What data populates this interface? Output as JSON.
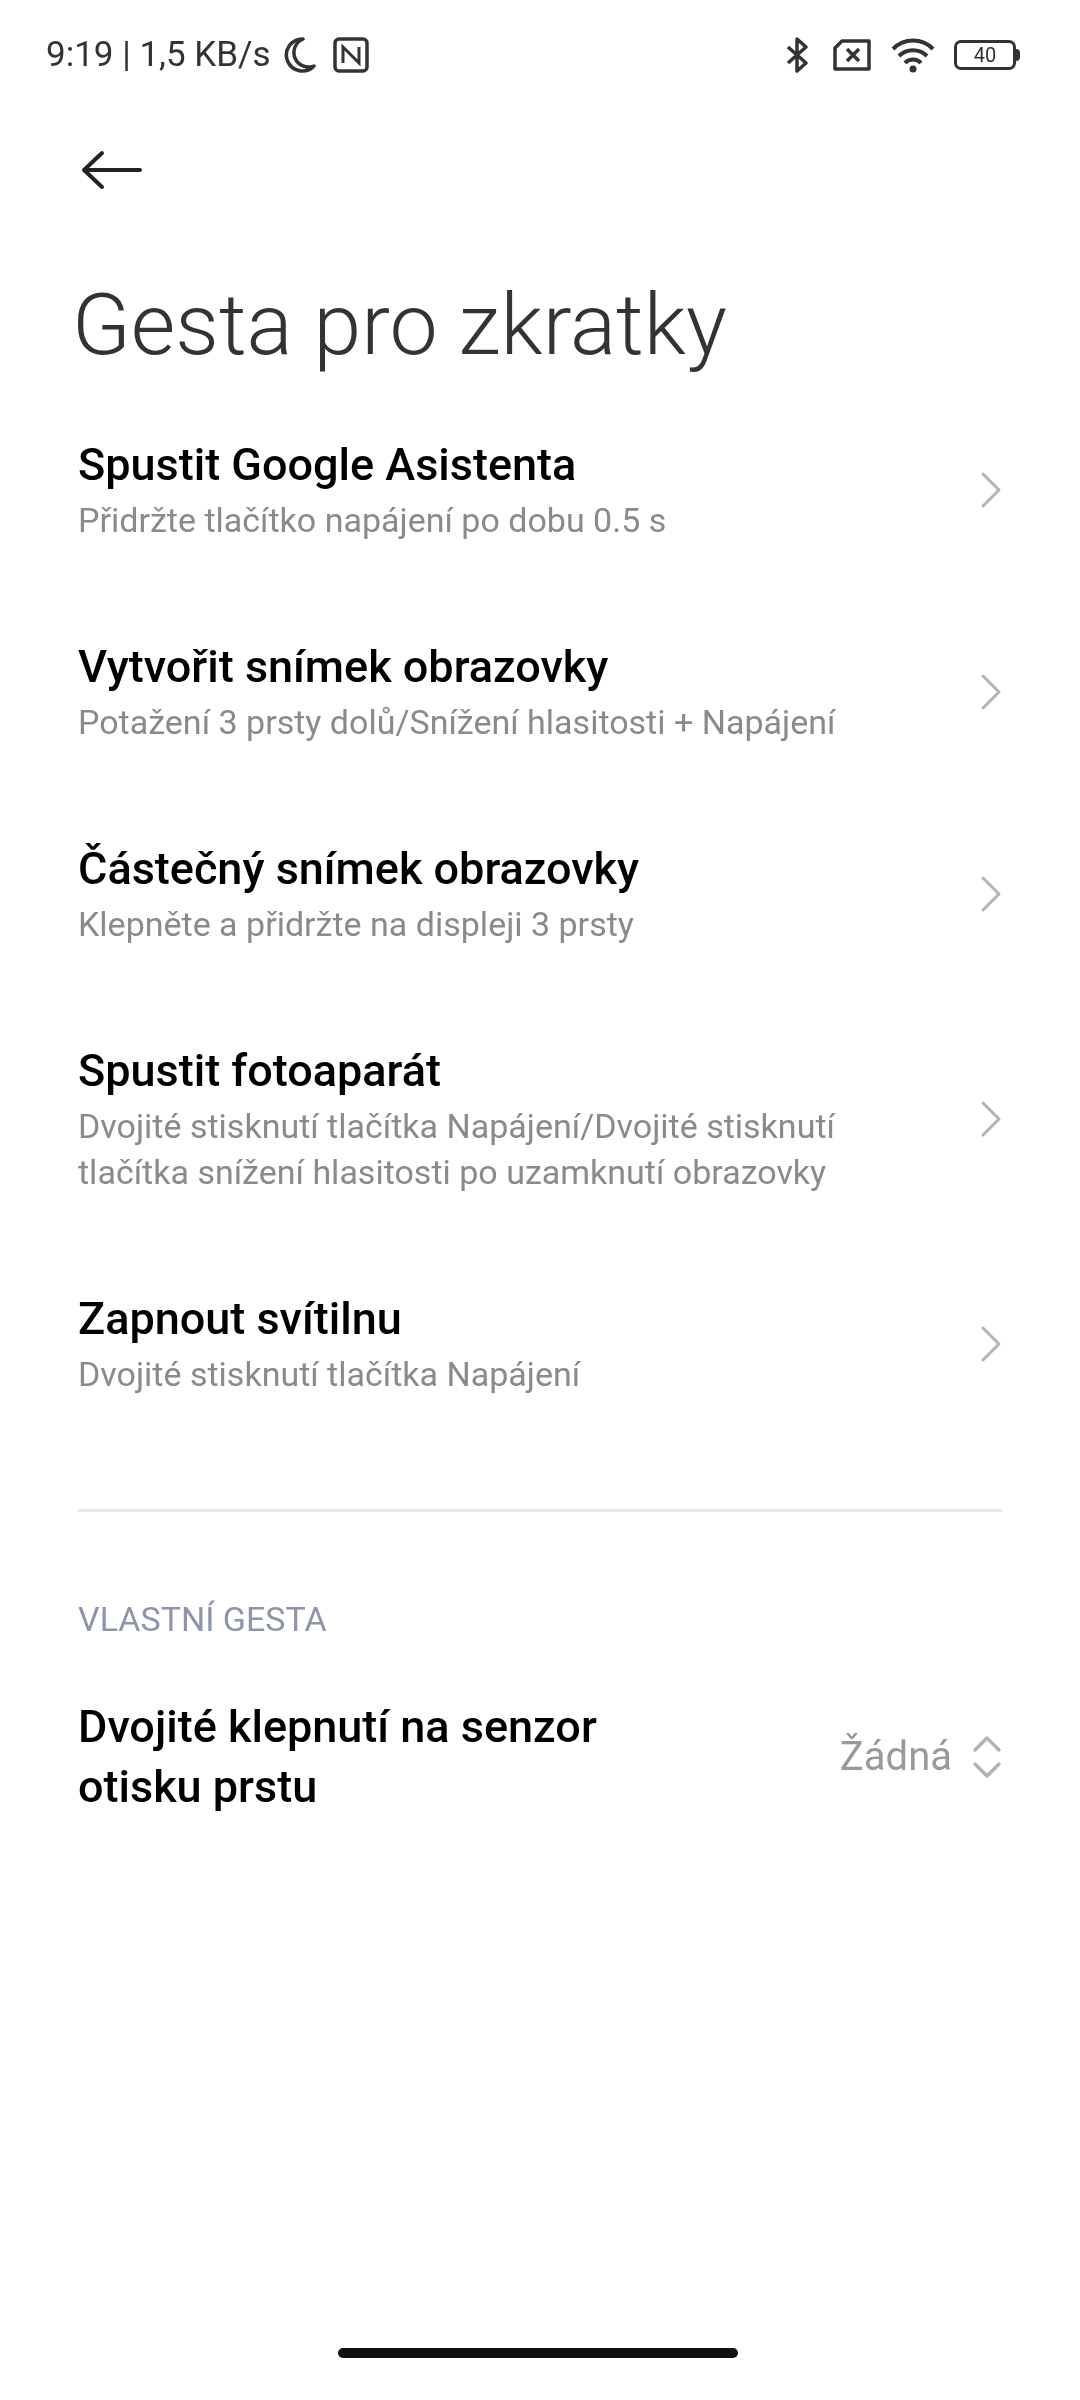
{
  "status_bar": {
    "time": "9:19 | 1,5 KB/s",
    "battery": "40"
  },
  "title": "Gesta pro zkratky",
  "items": [
    {
      "title": "Spustit Google Asistenta",
      "subtitle": "Přidržte tlačítko napájení po dobu 0.5 s"
    },
    {
      "title": "Vytvořit snímek obrazovky",
      "subtitle": "Potažení 3 prsty dolů/Snížení hlasitosti + Napájení"
    },
    {
      "title": "Částečný snímek obrazovky",
      "subtitle": "Klepněte a přidržte na displeji 3 prsty"
    },
    {
      "title": "Spustit fotoaparát",
      "subtitle": "Dvojité stisknutí tlačítka Napájení/Dvojité stisknutí tlačítka snížení hlasitosti po uzamknutí obrazovky"
    },
    {
      "title": "Zapnout svítilnu",
      "subtitle": "Dvojité stisknutí tlačítka Napájení"
    }
  ],
  "section": {
    "header": "VLASTNÍ GESTA",
    "items": [
      {
        "title": "Dvojité klepnutí na senzor otisku prstu",
        "value": "Žádná"
      }
    ]
  }
}
